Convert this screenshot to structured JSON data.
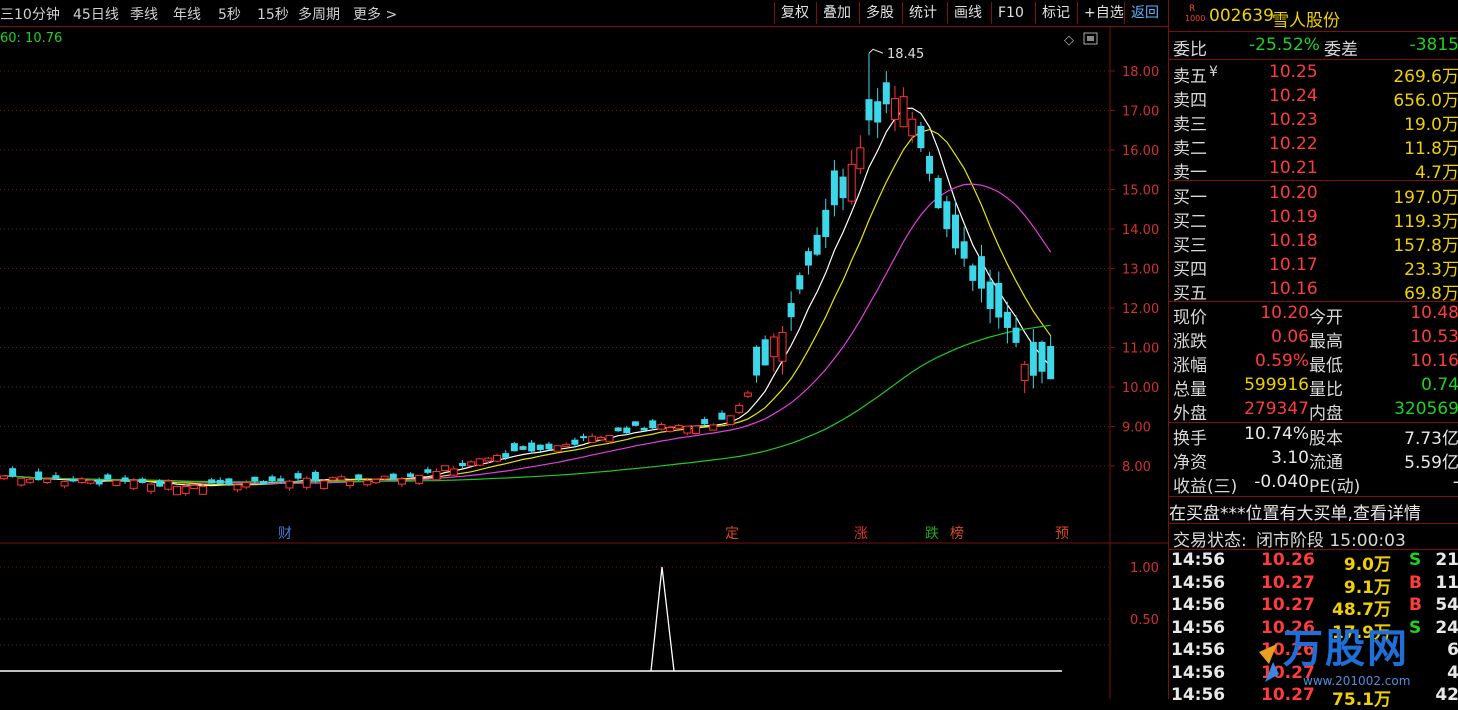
{
  "toolbar": {
    "periods": [
      "10分钟",
      "45日线",
      "季线",
      "年线",
      "5秒",
      "15秒",
      "多周期",
      "更多 >"
    ],
    "buttons": [
      "复权",
      "叠加",
      "多股",
      "统计",
      "画线",
      "F10",
      "标记",
      "+自选",
      "返回"
    ]
  },
  "legend": {
    "ma_text": "60: 10.76"
  },
  "price_axis": [
    "18.00",
    "17.00",
    "16.00",
    "15.00",
    "14.00",
    "13.00",
    "12.00",
    "11.00",
    "10.00",
    "9.00",
    "8.00"
  ],
  "indicator_axis": [
    "1.00",
    "0.50"
  ],
  "peak_label": "18.45",
  "event_markers": [
    {
      "text": "财",
      "color": "#3a7dd8"
    },
    {
      "text": "定",
      "color": "#d84a1a"
    },
    {
      "text": "涨",
      "color": "#d83030"
    },
    {
      "text": "跌",
      "color": "#1fa81f"
    },
    {
      "text": "榜",
      "color": "#d84a1a"
    },
    {
      "text": "预",
      "color": "#d84a1a"
    }
  ],
  "stock": {
    "badge_top": "R",
    "badge_bottom": "1000",
    "code": "002639",
    "name": "雪人股份"
  },
  "weibi": {
    "label": "委比",
    "value": "-25.52%",
    "diff_label": "委差",
    "diff_value": "-3815"
  },
  "sell": [
    {
      "label": "卖五",
      "mark": "¥",
      "price": "10.25",
      "vol": "269.6万"
    },
    {
      "label": "卖四",
      "mark": "",
      "price": "10.24",
      "vol": "656.0万"
    },
    {
      "label": "卖三",
      "mark": "",
      "price": "10.23",
      "vol": "19.0万"
    },
    {
      "label": "卖二",
      "mark": "",
      "price": "10.22",
      "vol": "11.8万"
    },
    {
      "label": "卖一",
      "mark": "",
      "price": "10.21",
      "vol": "4.7万"
    }
  ],
  "buy": [
    {
      "label": "买一",
      "price": "10.20",
      "vol": "197.0万"
    },
    {
      "label": "买二",
      "price": "10.19",
      "vol": "119.3万"
    },
    {
      "label": "买三",
      "price": "10.18",
      "vol": "157.8万"
    },
    {
      "label": "买四",
      "price": "10.17",
      "vol": "23.3万"
    },
    {
      "label": "买五",
      "price": "10.16",
      "vol": "69.8万"
    }
  ],
  "quote": [
    {
      "l1": "现价",
      "v1": "10.20",
      "c1": "red",
      "l2": "今开",
      "v2": "10.48",
      "c2": "red"
    },
    {
      "l1": "涨跌",
      "v1": "0.06",
      "c1": "red",
      "l2": "最高",
      "v2": "10.53",
      "c2": "red"
    },
    {
      "l1": "涨幅",
      "v1": "0.59%",
      "c1": "red",
      "l2": "最低",
      "v2": "10.16",
      "c2": "red"
    },
    {
      "l1": "总量",
      "v1": "599916",
      "c1": "yel",
      "l2": "量比",
      "v2": "0.74",
      "c2": "grn"
    },
    {
      "l1": "外盘",
      "v1": "279347",
      "c1": "red",
      "l2": "内盘",
      "v2": "320569",
      "c2": "grn"
    }
  ],
  "fund": [
    {
      "l1": "换手",
      "v1": "10.74%",
      "l2": "股本",
      "v2": "7.73亿"
    },
    {
      "l1": "净资",
      "v1": "3.10",
      "l2": "流通",
      "v2": "5.59亿"
    },
    {
      "l1": "收益(三)",
      "v1": "-0.040",
      "l2": "PE(动)",
      "v2": "-"
    }
  ],
  "notice": "在买盘***位置有大买单,查看详情",
  "status": {
    "label": "交易状态:",
    "value": "闭市阶段 15:00:03"
  },
  "ticks": [
    {
      "time": "14:56",
      "price": "10.26",
      "vol": "9.0万",
      "side": "S",
      "n": "21"
    },
    {
      "time": "14:56",
      "price": "10.27",
      "vol": "9.1万",
      "side": "B",
      "n": "11"
    },
    {
      "time": "14:56",
      "price": "10.27",
      "vol": "48.7万",
      "side": "B",
      "n": "54"
    },
    {
      "time": "14:56",
      "price": "10.26",
      "vol": "17.9万",
      "side": "S",
      "n": "24"
    },
    {
      "time": "14:56",
      "price": "10.26",
      "vol": "",
      "side": "",
      "n": "6"
    },
    {
      "time": "14:56",
      "price": "10.27",
      "vol": "",
      "side": "",
      "n": "4"
    },
    {
      "time": "14:56",
      "price": "10.27",
      "vol": "75.1万",
      "side": "",
      "n": "42"
    }
  ],
  "watermark": {
    "text": "万股网",
    "url": "www.201002.com"
  },
  "colors": {
    "up": "#ff3232",
    "down": "#3cd7e8",
    "ma5": "#ffffff",
    "ma10": "#e6e600",
    "ma20": "#e040e0",
    "ma60": "#20c820",
    "grid": "#7a1010"
  }
}
